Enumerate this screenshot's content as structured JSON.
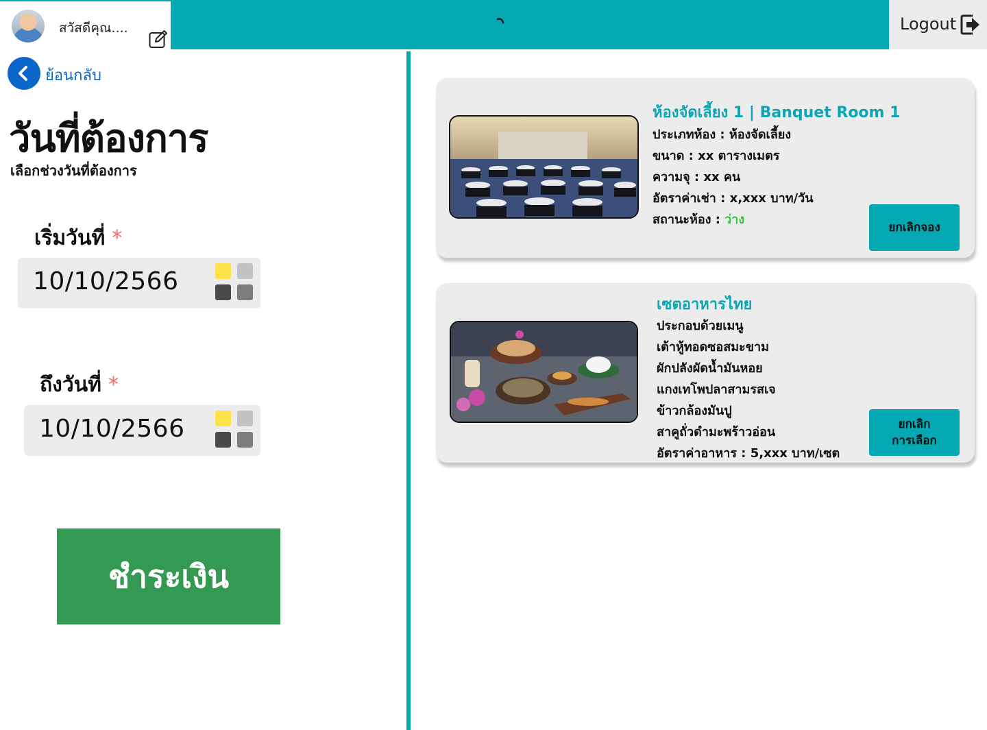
{
  "header": {
    "greeting": "สวัสดีคุณ....",
    "logout_label": "Logout",
    "accent_color": "#05a9b3"
  },
  "back": {
    "label": "ย้อนกลับ"
  },
  "page": {
    "title": "วันที่ต้องการ",
    "subtitle": "เลือกช่วงวันที่ต้องการ"
  },
  "start_date": {
    "label": "เริ่มวันที่",
    "required_mark": "*",
    "value": "10/10/2566"
  },
  "end_date": {
    "label": "ถึงวันที่",
    "required_mark": "*",
    "value": "10/10/2566"
  },
  "pay_button": {
    "label": "ชำระเงิน",
    "color": "#349a53"
  },
  "cards": [
    {
      "title": "ห้องจัดเลี้ยง 1 | Banquet Room 1",
      "lines": [
        "ประเภทห้อง : ห้องจัดเลี้ยง",
        "ขนาด  :   xx ตารางเมตร",
        "ความจุ :  xx คน",
        "อัตราค่าเช่า : x,xxx บาท/วัน"
      ],
      "status_label": "สถานะห้อง : ",
      "status_value": "ว่าง",
      "status_color": "#37c43a",
      "button_label": "ยกเลิกจอง"
    },
    {
      "title": "เซตอาหารไทย",
      "lines": [
        "ประกอบด้วยเมนู",
        "เต้าหู้ทอดซอสมะขาม",
        "ผักปลังผัดน้ำมันหอย",
        "แกงเทโพปลาสามรสเจ",
        "ข้าวกล้องมันปู",
        "สาคูถั่วดำมะพร้าวอ่อน",
        "อัตราค่าอาหาร : 5,xxx บาท/เซต"
      ],
      "button_line1": "ยกเลิก",
      "button_line2": "การเลือก"
    }
  ]
}
